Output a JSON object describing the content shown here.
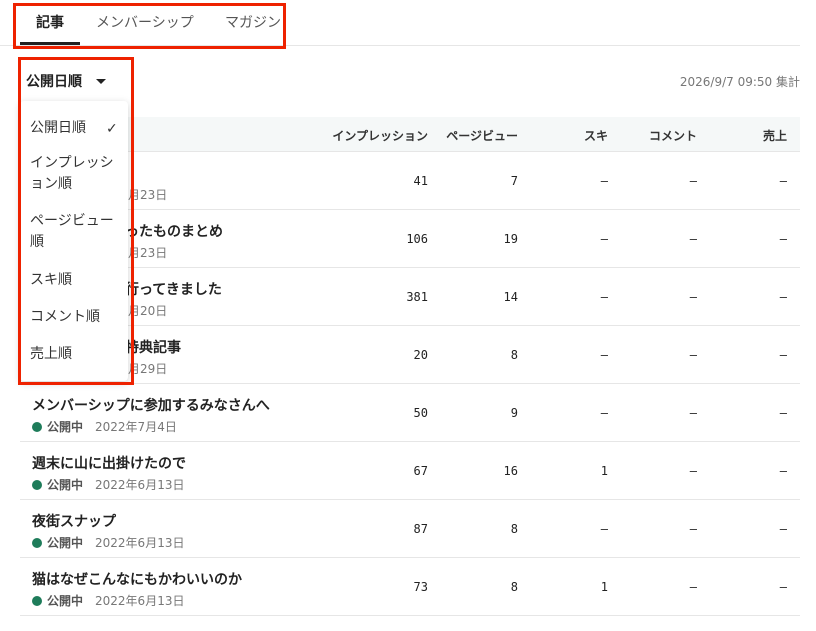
{
  "tabs": [
    {
      "label": "記事"
    },
    {
      "label": "メンバーシップ"
    },
    {
      "label": "マガジン"
    }
  ],
  "sort": {
    "current": "公開日順",
    "options": [
      {
        "label": "公開日順",
        "selected": true
      },
      {
        "label": "インプレッション順"
      },
      {
        "label": "ページビュー順"
      },
      {
        "label": "スキ順"
      },
      {
        "label": "コメント順"
      },
      {
        "label": "売上順"
      }
    ]
  },
  "timestamp": "2026/9/7 09:50 集計",
  "columns": [
    "インプレッション",
    "ページビュー",
    "スキ",
    "コメント",
    "売上"
  ],
  "rows": [
    {
      "title": "",
      "status": "",
      "date": "月23日",
      "impressions": "41",
      "pageviews": "7",
      "likes": "–",
      "comments": "–",
      "sales": "–"
    },
    {
      "title": "ったものまとめ",
      "status": "",
      "date": "月23日",
      "impressions": "106",
      "pageviews": "19",
      "likes": "–",
      "comments": "–",
      "sales": "–"
    },
    {
      "title": "行ってきました",
      "status": "",
      "date": "月20日",
      "impressions": "381",
      "pageviews": "14",
      "likes": "–",
      "comments": "–",
      "sales": "–"
    },
    {
      "title": "特典記事",
      "status": "",
      "date": "月29日",
      "impressions": "20",
      "pageviews": "8",
      "likes": "–",
      "comments": "–",
      "sales": "–"
    },
    {
      "title": "メンバーシップに参加するみなさんへ",
      "status": "公開中",
      "date": "2022年7月4日",
      "impressions": "50",
      "pageviews": "9",
      "likes": "–",
      "comments": "–",
      "sales": "–"
    },
    {
      "title": "週末に山に出掛けたので",
      "status": "公開中",
      "date": "2022年6月13日",
      "impressions": "67",
      "pageviews": "16",
      "likes": "1",
      "comments": "–",
      "sales": "–"
    },
    {
      "title": "夜街スナップ",
      "status": "公開中",
      "date": "2022年6月13日",
      "impressions": "87",
      "pageviews": "8",
      "likes": "–",
      "comments": "–",
      "sales": "–"
    },
    {
      "title": "猫はなぜこんなにもかわいいのか",
      "status": "公開中",
      "date": "2022年6月13日",
      "impressions": "73",
      "pageviews": "8",
      "likes": "1",
      "comments": "–",
      "sales": "–"
    }
  ],
  "colors": {
    "accent": "#1e7c5a",
    "highlight": "#ee2200"
  }
}
